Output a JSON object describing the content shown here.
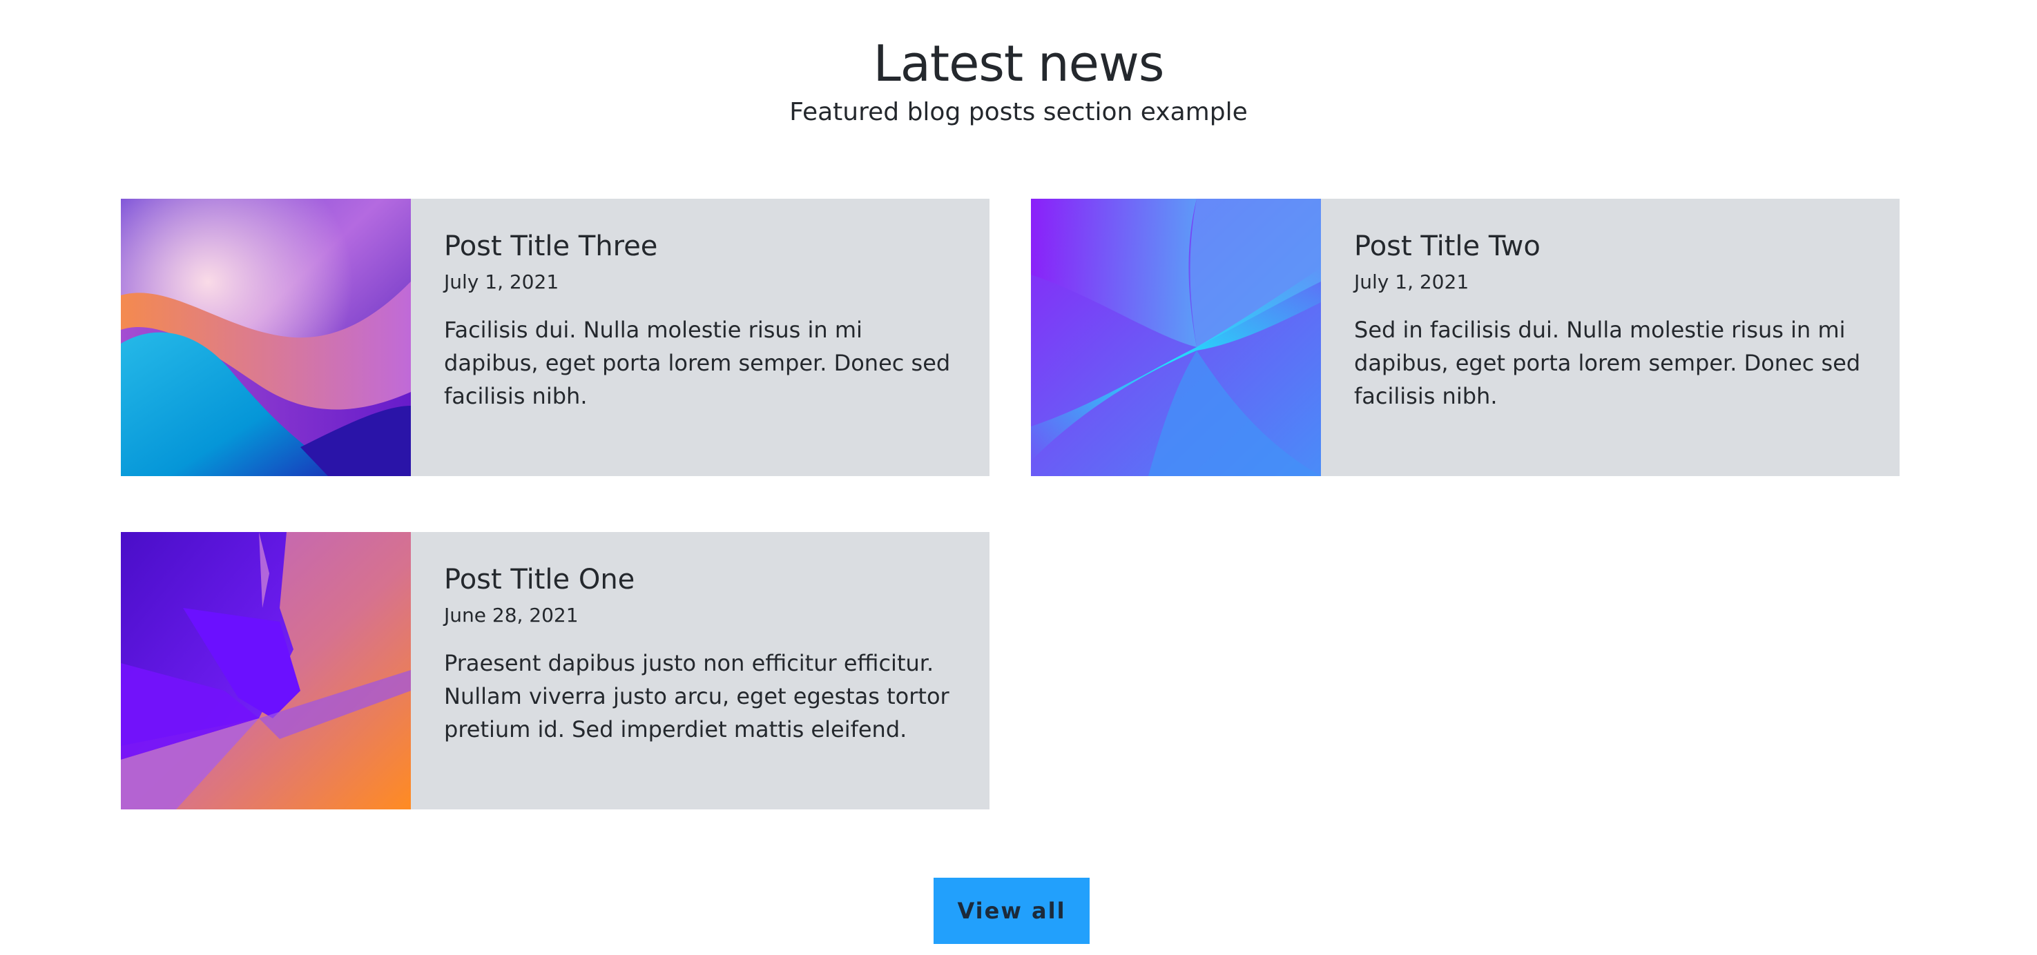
{
  "header": {
    "title": "Latest news",
    "subtitle": "Featured blog posts section example"
  },
  "posts": [
    {
      "title": "Post Title Three",
      "date": "July 1, 2021",
      "excerpt": "Facilisis dui. Nulla molestie risus in mi dapibus, eget porta lorem semper. Donec sed facilisis nibh."
    },
    {
      "title": "Post Title Two",
      "date": "July 1, 2021",
      "excerpt": "Sed in facilisis dui. Nulla molestie risus in mi dapibus, eget porta lorem semper. Donec sed facilisis nibh."
    },
    {
      "title": "Post Title One",
      "date": "June 28, 2021",
      "excerpt": "Praesent dapibus justo non efficitur efficitur. Nullam viverra justo arcu, eget egestas tortor pretium id. Sed imperdiet mattis eleifend."
    }
  ],
  "actions": {
    "view_all_label": "View all"
  },
  "colors": {
    "card_background": "#dadde1",
    "button_background": "#22a0fc",
    "text": "#24282d"
  }
}
